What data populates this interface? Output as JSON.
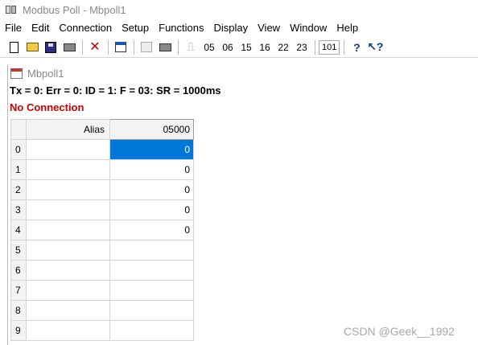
{
  "window": {
    "title": "Modbus Poll - Mbpoll1"
  },
  "menu": [
    "File",
    "Edit",
    "Connection",
    "Setup",
    "Functions",
    "Display",
    "View",
    "Window",
    "Help"
  ],
  "toolbar": {
    "function_codes": [
      "05",
      "06",
      "15",
      "16",
      "22",
      "23"
    ],
    "count_label": "101"
  },
  "child": {
    "title": "Mbpoll1",
    "status": "Tx = 0: Err = 0: ID = 1: F = 03: SR = 1000ms",
    "connection": "No Connection"
  },
  "grid": {
    "columns": [
      "Alias",
      "05000"
    ],
    "rows": [
      {
        "index": "0",
        "alias": "",
        "value": "0",
        "selected": true
      },
      {
        "index": "1",
        "alias": "",
        "value": "0"
      },
      {
        "index": "2",
        "alias": "",
        "value": "0"
      },
      {
        "index": "3",
        "alias": "",
        "value": "0"
      },
      {
        "index": "4",
        "alias": "",
        "value": "0"
      },
      {
        "index": "5",
        "alias": "",
        "value": ""
      },
      {
        "index": "6",
        "alias": "",
        "value": ""
      },
      {
        "index": "7",
        "alias": "",
        "value": ""
      },
      {
        "index": "8",
        "alias": "",
        "value": ""
      },
      {
        "index": "9",
        "alias": "",
        "value": ""
      }
    ]
  },
  "watermark": "CSDN @Geek__1992",
  "colors": {
    "selection": "#0078d7",
    "error_text": "#cc0000"
  }
}
